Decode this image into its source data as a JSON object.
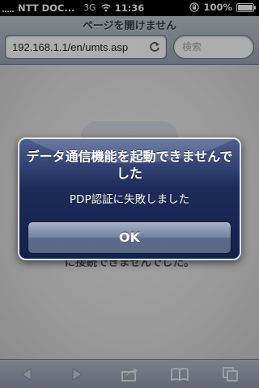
{
  "status_bar": {
    "carrier": "NTT DOC...",
    "network": "3G",
    "time": "11:36",
    "battery": "100%"
  },
  "header": {
    "title": "ページを開けません",
    "url": "192.168.1.1/en/umts.asp",
    "search_placeholder": "検索"
  },
  "page": {
    "error_message": "ページを開けません。Safari はサーバに接続できませんでした。"
  },
  "alert": {
    "title": "データ通信機能を起動できませんでした",
    "message": "PDP認証に失敗しました",
    "ok_label": "OK"
  },
  "toolbar": {
    "icons": [
      "back-icon",
      "forward-icon",
      "share-icon",
      "bookmarks-icon",
      "pages-icon"
    ]
  },
  "colors": {
    "alert_top": "#4c5e8f",
    "alert_bottom": "#13214a",
    "toolbar": "#9aa5b4"
  }
}
